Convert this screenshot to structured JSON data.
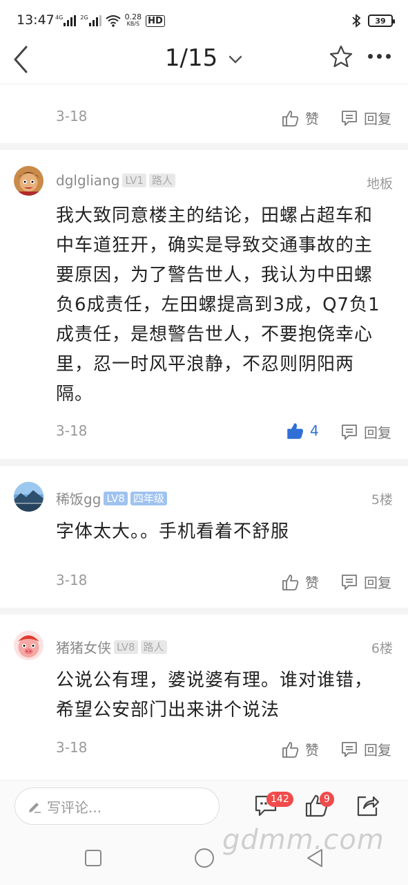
{
  "status": {
    "time": "13:47",
    "net_top": "0.28",
    "net_bottom": "KB/S",
    "sig1": "4G",
    "sig2": "2G",
    "hd": "HD",
    "battery": "39"
  },
  "nav": {
    "title": "1/15"
  },
  "posts": [
    {
      "date": "3-18",
      "like_label": "赞",
      "reply_label": "回复"
    },
    {
      "username": "dglgliang",
      "level": "LV1",
      "tag": "路人",
      "floor": "地板",
      "content": "我大致同意楼主的结论，田螺占超车和中车道狂开，确实是导致交通事故的主要原因，为了警告世人，我认为中田螺负6成责任，左田螺提高到3成，Q7负1成责任，是想警告世人，不要抱侥幸心里，忍一时风平浪静，不忍则阴阳两隔。",
      "date": "3-18",
      "like_count": "4",
      "reply_label": "回复"
    },
    {
      "username": "稀饭gg",
      "level": "LV8",
      "tag": "四年级",
      "floor": "5楼",
      "content": "字体太大。。手机看着不舒服",
      "date": "3-18",
      "like_label": "赞",
      "reply_label": "回复"
    },
    {
      "username": "猪猪女侠",
      "level": "LV8",
      "tag": "路人",
      "floor": "6楼",
      "content": "公说公有理，婆说婆有理。谁对谁错，希望公安部门出来讲个说法",
      "date": "3-18",
      "like_label": "赞",
      "reply_label": "回复"
    }
  ],
  "bottom": {
    "placeholder": "写评论...",
    "comment_count": "142",
    "like_count": "9"
  },
  "watermark": "gdmm.com",
  "colors": {
    "accent": "#2f6fd6",
    "badge_red": "#f04b4b",
    "level_blue": "#9fc3f0"
  }
}
